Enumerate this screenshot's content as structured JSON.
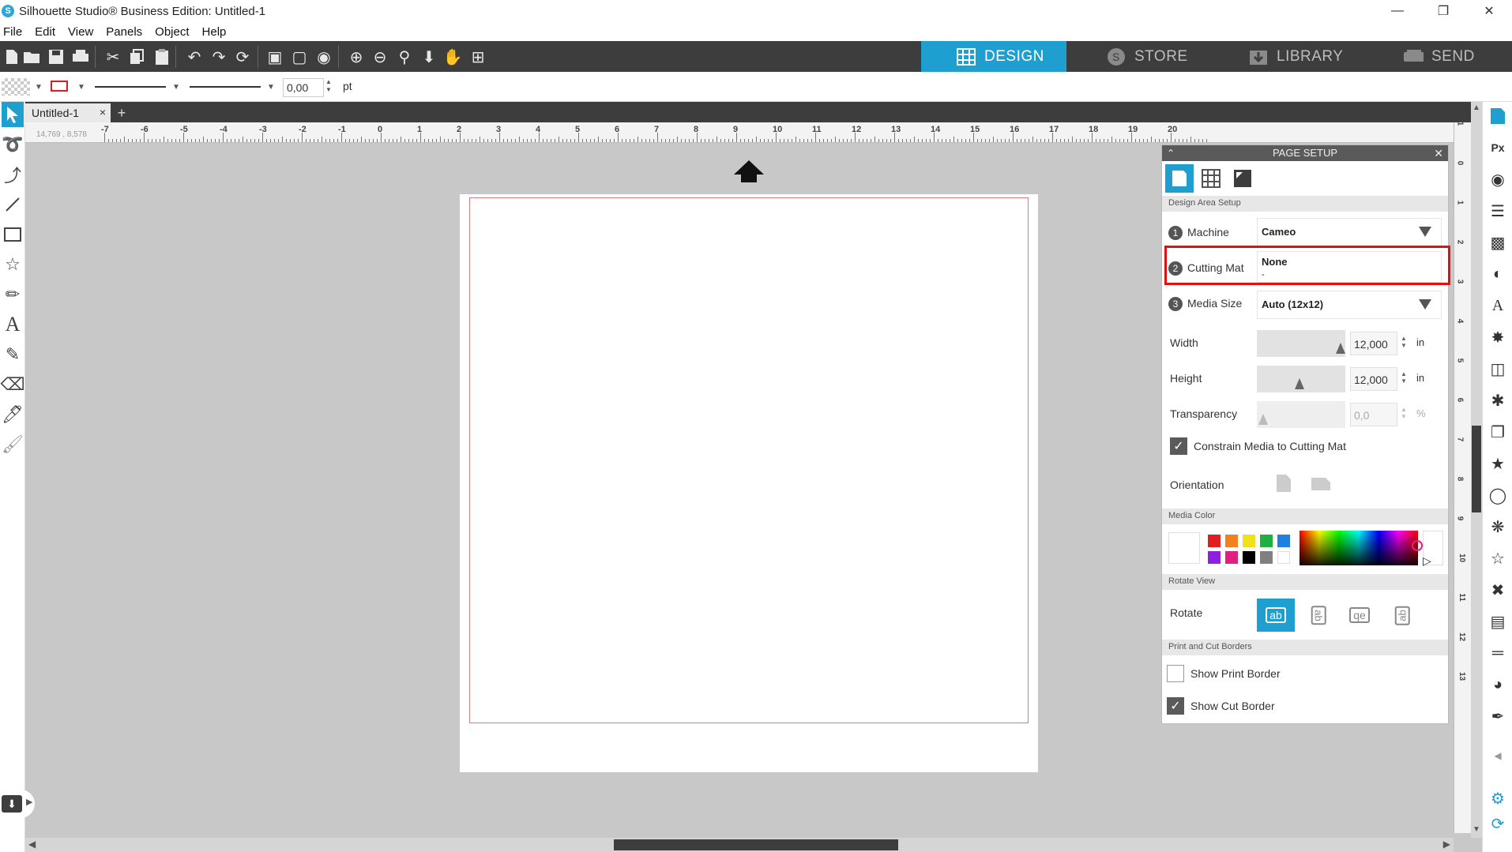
{
  "window": {
    "title": "Silhouette Studio® Business Edition: Untitled-1",
    "app_logo": "S"
  },
  "menu": [
    "File",
    "Edit",
    "View",
    "Panels",
    "Object",
    "Help"
  ],
  "nav_tabs": [
    {
      "label": "DESIGN",
      "active": true
    },
    {
      "label": "STORE",
      "active": false
    },
    {
      "label": "LIBRARY",
      "active": false
    },
    {
      "label": "SEND",
      "active": false
    }
  ],
  "style_bar": {
    "line_width": "0,00",
    "unit": "pt"
  },
  "document": {
    "tab_label": "Untitled-1",
    "close": "×",
    "add": "+"
  },
  "ruler": {
    "coords": "14,769 , 8,578",
    "h_labels": [
      "-7",
      "-6",
      "-5",
      "-4",
      "-3",
      "-2",
      "-1",
      "0",
      "1",
      "2",
      "3",
      "4",
      "5",
      "6",
      "7",
      "8",
      "9",
      "10",
      "11",
      "12",
      "13",
      "14",
      "15",
      "16",
      "17",
      "18",
      "19",
      "20"
    ],
    "v_labels": [
      "1",
      "0",
      "1",
      "2",
      "3",
      "4",
      "5",
      "6",
      "7",
      "8",
      "9",
      "10",
      "11",
      "12",
      "13"
    ]
  },
  "panel": {
    "title": "PAGE SETUP",
    "sections": {
      "design_area": "Design Area Setup",
      "media_color": "Media Color",
      "rotate_view": "Rotate View",
      "print_cut": "Print and Cut Borders"
    },
    "machine": {
      "num": "1",
      "label": "Machine",
      "value": "Cameo"
    },
    "cutting_mat": {
      "num": "2",
      "label": "Cutting Mat",
      "value": "None",
      "sub": "-"
    },
    "media_size": {
      "num": "3",
      "label": "Media Size",
      "value": "Auto (12x12)"
    },
    "width": {
      "label": "Width",
      "value": "12,000",
      "unit": "in"
    },
    "height": {
      "label": "Height",
      "value": "12,000",
      "unit": "in"
    },
    "transparency": {
      "label": "Transparency",
      "value": "0,0",
      "unit": "%"
    },
    "constrain": {
      "label": "Constrain Media to Cutting Mat",
      "checked": true
    },
    "orientation": {
      "label": "Orientation"
    },
    "rotate": {
      "label": "Rotate",
      "options": [
        "ab",
        "ab",
        "qe",
        "ab"
      ]
    },
    "show_print_border": {
      "label": "Show Print Border",
      "checked": false
    },
    "show_cut_border": {
      "label": "Show Cut Border",
      "checked": true
    },
    "swatches": [
      "#e02020",
      "#f08020",
      "#f0e020",
      "#20b040",
      "#2080e0",
      "#9020e0",
      "#e02080",
      "#000000",
      "#808080",
      "#ffffff"
    ]
  }
}
